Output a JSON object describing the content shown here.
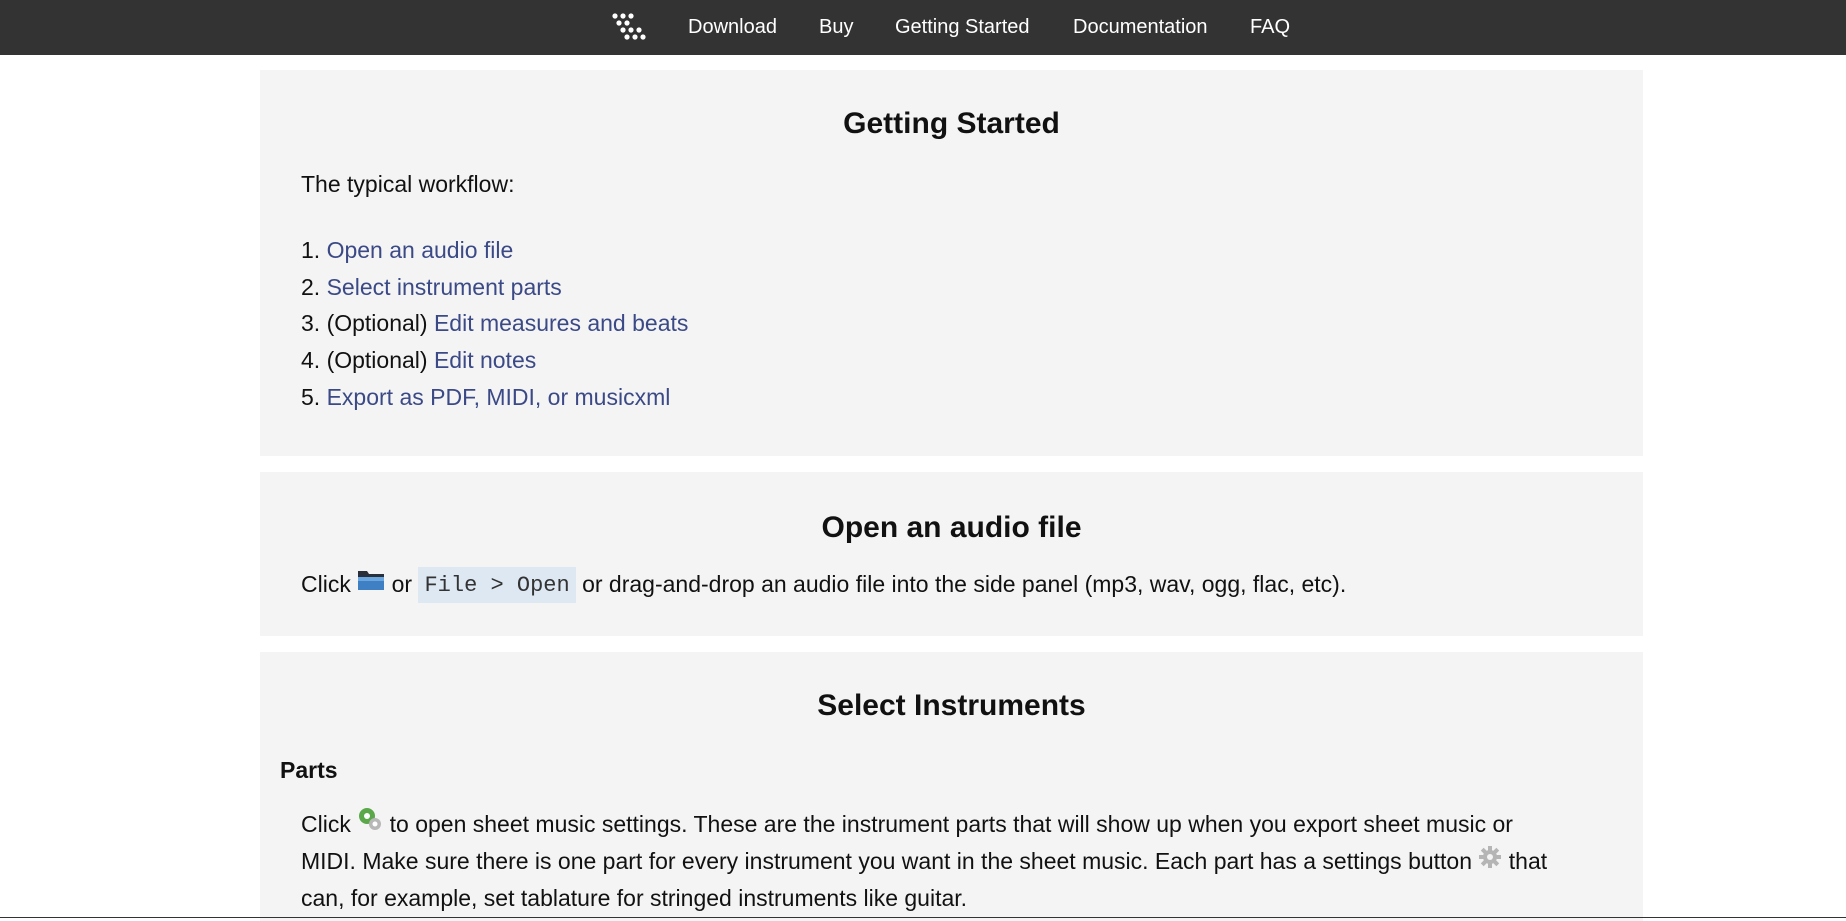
{
  "nav": {
    "logo_icon": "dotted-triangle-logo",
    "links": [
      "Download",
      "Buy",
      "Getting Started",
      "Documentation",
      "FAQ"
    ]
  },
  "getting_started": {
    "title": "Getting Started",
    "intro": "The typical workflow:",
    "steps": [
      {
        "num": "1.",
        "prefix": "",
        "link": "Open an audio file"
      },
      {
        "num": "2.",
        "prefix": "",
        "link": "Select instrument parts"
      },
      {
        "num": "3.",
        "prefix": "(Optional)",
        "link": "Edit measures and beats"
      },
      {
        "num": "4.",
        "prefix": "(Optional)",
        "link": "Edit notes"
      },
      {
        "num": "5.",
        "prefix": "",
        "link": "Export as PDF, MIDI, or musicxml"
      }
    ]
  },
  "open_audio": {
    "title": "Open an audio file",
    "text_before": "Click",
    "icon": "folder-icon",
    "text_or": "or",
    "code": "File > Open",
    "text_after": "or drag-and-drop an audio file into the side panel (mp3, wav, ogg, flac, etc)."
  },
  "select_instruments": {
    "title": "Select Instruments",
    "parts_heading": "Parts",
    "line1_before": "Click",
    "line1_icon": "sheet-settings-icon",
    "line1_after": "to open sheet music settings. These are the instrument parts that will show up when you export sheet music or",
    "line2_before": "MIDI. Make sure there is one part for every instrument you want in the sheet music. Each part has a settings button",
    "line2_icon": "gear-icon",
    "line2_after": "that",
    "line3": "can, for example, set tablature for stringed instruments like guitar."
  },
  "colors": {
    "nav_bg": "#333333",
    "card_bg": "#f4f4f4",
    "link": "#3b4a86",
    "code_bg": "#dde8f3"
  }
}
